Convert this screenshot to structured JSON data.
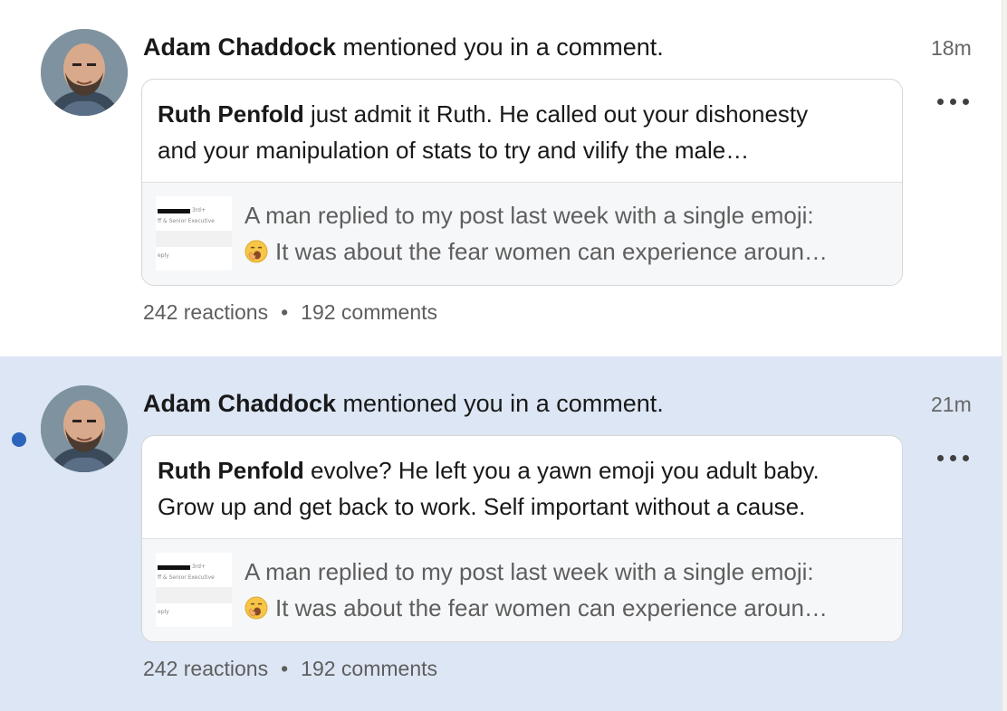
{
  "notifications": [
    {
      "unread": false,
      "actor": "Adam Chaddock",
      "action": " mentioned you in a comment.",
      "time": "18m",
      "comment_author": "Ruth Penfold",
      "comment_line1": " just admit it Ruth. He called out your dishonesty",
      "comment_line2": "and your manipulation of stats to try and vilify the male…",
      "post_line1": "A man replied to my post last week with a single emoji:",
      "post_line2": "It was about the fear women can experience aroun…",
      "post_emoji": "yawning-face-emoji",
      "reactions": "242 reactions",
      "separator": "•",
      "comments": "192 comments"
    },
    {
      "unread": true,
      "actor": "Adam Chaddock",
      "action": " mentioned you in a comment.",
      "time": "21m",
      "comment_author": "Ruth Penfold",
      "comment_line1": " evolve? He left you a yawn emoji you adult baby.",
      "comment_line2": "Grow up and get back to work. Self important without a cause.",
      "post_line1": "A man replied to my post last week with a single emoji:",
      "post_line2": "It was about the fear women can experience aroun…",
      "post_emoji": "yawning-face-emoji",
      "reactions": "242 reactions",
      "separator": "•",
      "comments": "192 comments"
    }
  ],
  "thumbnail_text": {
    "degree": "3rd+",
    "title": "ff & Senior Executive",
    "reply": "eply"
  },
  "colors": {
    "unread_background": "#dce6f4",
    "unread_dot": "#2d64bc",
    "secondary_text": "#5e5e5e"
  }
}
